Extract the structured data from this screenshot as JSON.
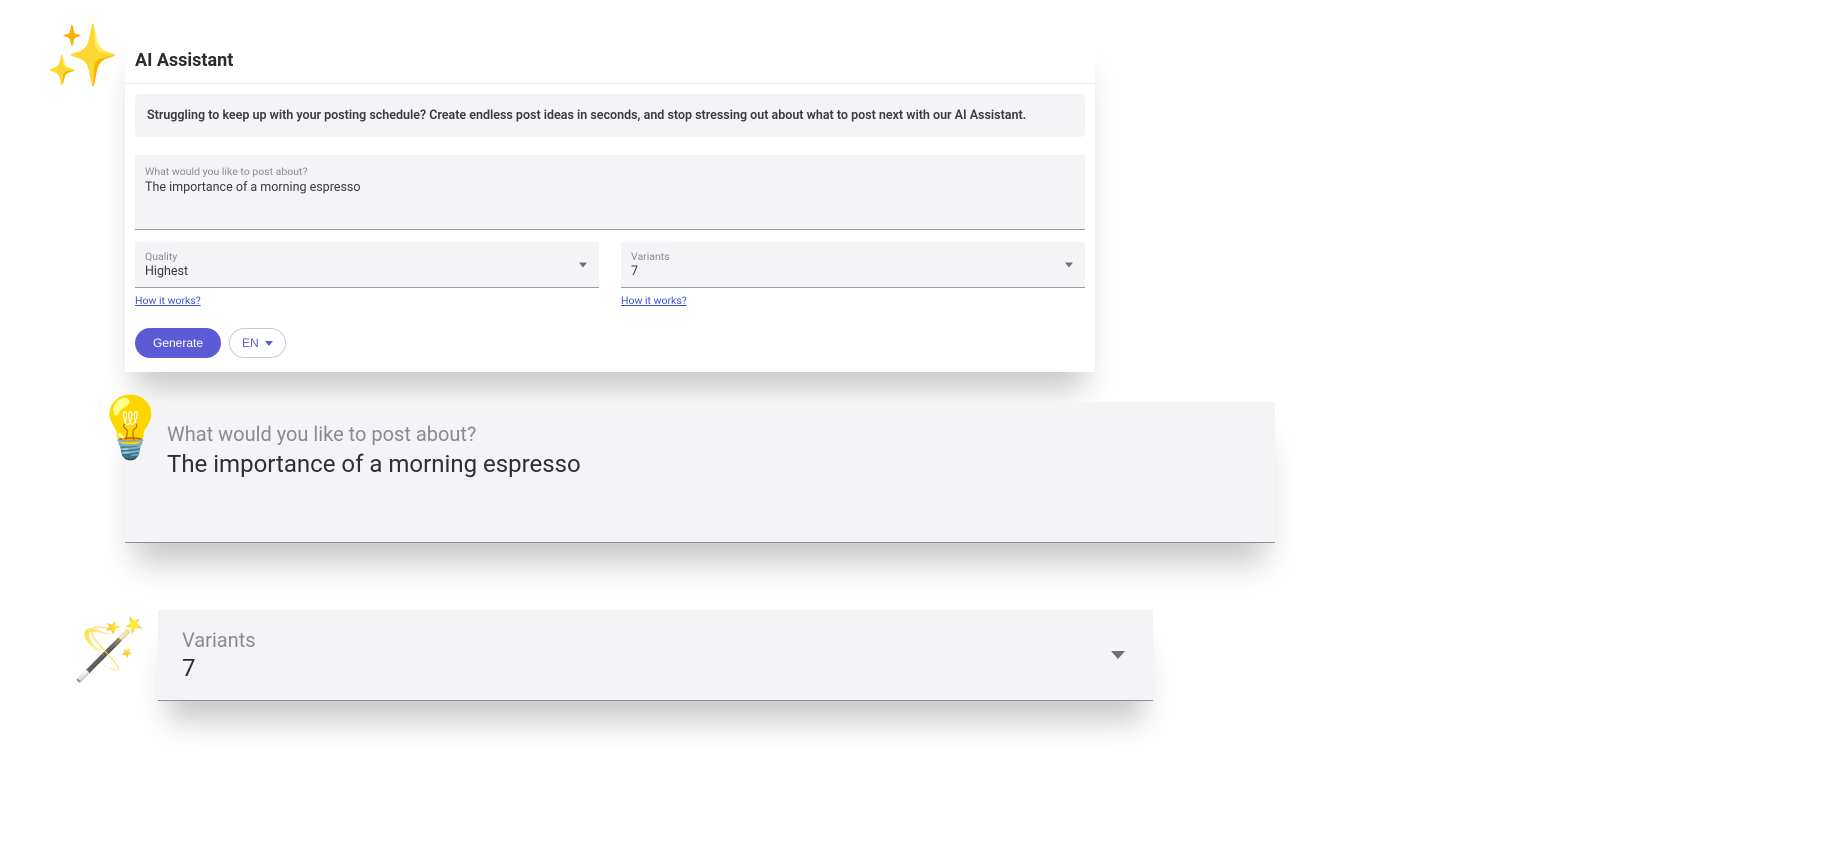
{
  "decor": {
    "sparkles": "✨",
    "bulb": "💡",
    "wand": "🪄"
  },
  "panel1": {
    "title": "AI Assistant",
    "info": "Struggling to keep up with your posting schedule? Create endless post ideas in seconds, and stop stressing out about what to post next with our AI Assistant.",
    "prompt": {
      "label": "What would you like to post about?",
      "value": "The importance of a morning espresso"
    },
    "quality": {
      "label": "Quality",
      "value": "Highest",
      "help": "How it works?"
    },
    "variants": {
      "label": "Variants",
      "value": "7",
      "help": "How it works?"
    },
    "generate_label": "Generate",
    "lang_label": "EN"
  },
  "panel2": {
    "label": "What would you like to post about?",
    "value": "The importance of a morning espresso"
  },
  "panel3": {
    "label": "Variants",
    "value": "7"
  }
}
